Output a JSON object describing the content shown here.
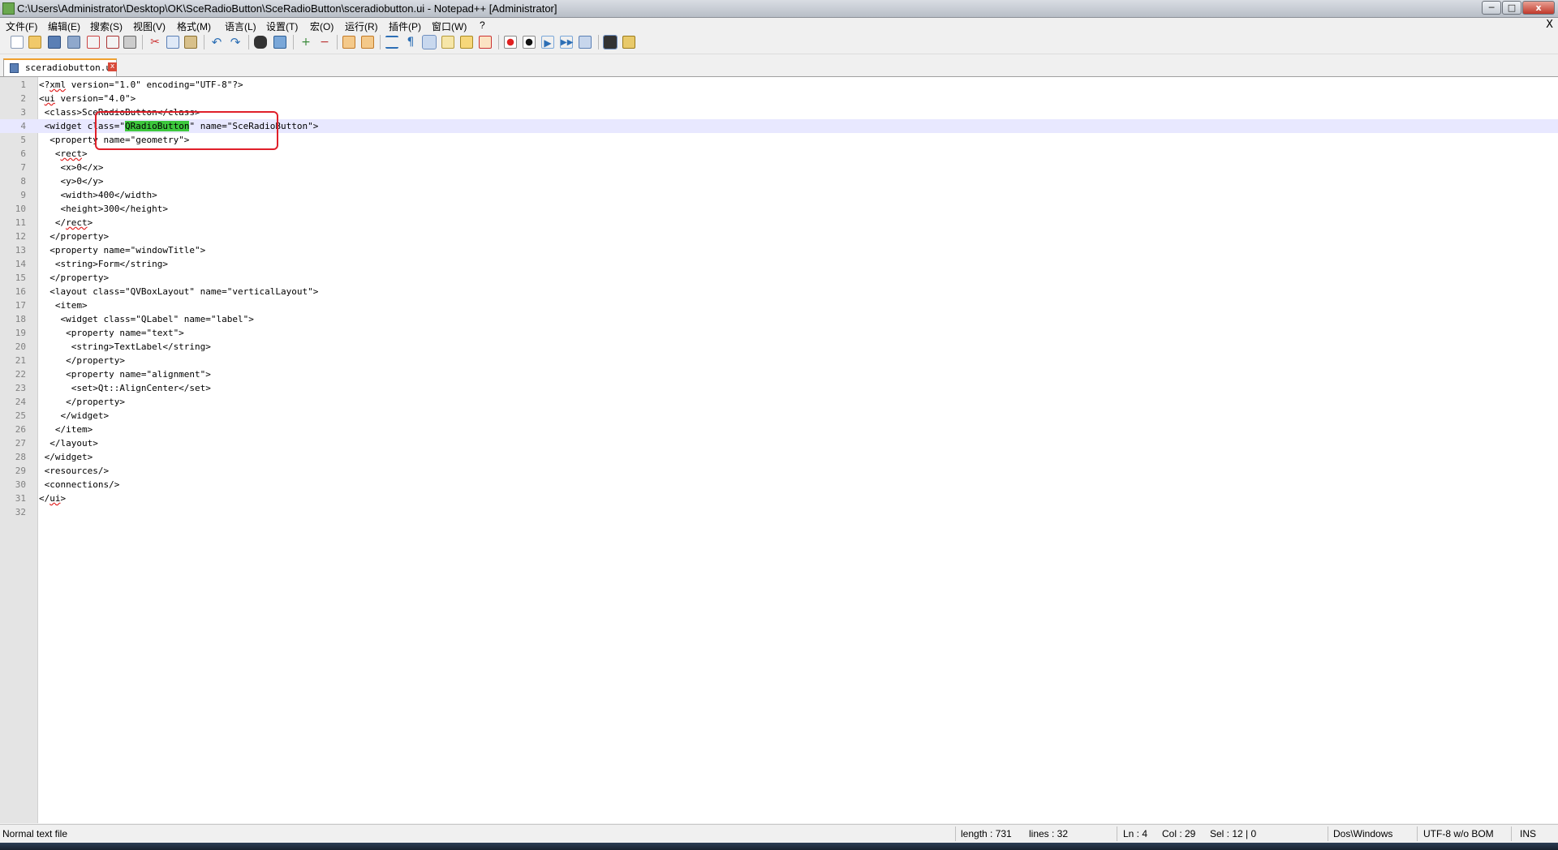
{
  "window": {
    "title": "C:\\Users\\Administrator\\Desktop\\OK\\SceRadioButton\\SceRadioButton\\sceradiobutton.ui - Notepad++ [Administrator]",
    "btn_min": "─",
    "btn_max": "□",
    "btn_close": "x"
  },
  "menu": {
    "items": [
      "文件(F)",
      "编辑(E)",
      "搜索(S)",
      "视图(V)",
      "格式(M)",
      "语言(L)",
      "设置(T)",
      "宏(O)",
      "运行(R)",
      "插件(P)",
      "窗口(W)",
      "?"
    ],
    "close_doc": "X"
  },
  "toolbar": {
    "icons": [
      "new-file-icon",
      "open-file-icon",
      "save-icon",
      "save-all-icon",
      "close-icon",
      "close-all-icon",
      "print-icon",
      "cut-icon",
      "copy-icon",
      "paste-icon",
      "undo-icon",
      "redo-icon",
      "find-icon",
      "replace-icon",
      "zoom-in-icon",
      "zoom-out-icon",
      "sync-vertical-icon",
      "sync-horizontal-icon",
      "word-wrap-icon",
      "show-all-chars-icon",
      "indent-guide-icon",
      "doc-map-icon",
      "function-list-icon",
      "folder-workspace-icon",
      "record-macro-icon",
      "stop-record-icon",
      "play-macro-icon",
      "run-macro-multiple-icon",
      "save-macro-icon",
      "spell-check-icon",
      "spell-options-icon"
    ]
  },
  "tab": {
    "filename": "sceradiobutton.ui",
    "close": "x"
  },
  "editor": {
    "lines": [
      {
        "n": "1",
        "text": "<?xml version=\"1.0\" encoding=\"UTF-8\"?>"
      },
      {
        "n": "2",
        "text": "<ui version=\"4.0\">"
      },
      {
        "n": "3",
        "text": " <class>SceRadioButton</class>"
      },
      {
        "n": "4",
        "text": " <widget class=\"QRadioButton\" name=\"SceRadioButton\">"
      },
      {
        "n": "5",
        "text": "  <property name=\"geometry\">"
      },
      {
        "n": "6",
        "text": "   <rect>"
      },
      {
        "n": "7",
        "text": "    <x>0</x>"
      },
      {
        "n": "8",
        "text": "    <y>0</y>"
      },
      {
        "n": "9",
        "text": "    <width>400</width>"
      },
      {
        "n": "10",
        "text": "    <height>300</height>"
      },
      {
        "n": "11",
        "text": "   </rect>"
      },
      {
        "n": "12",
        "text": "  </property>"
      },
      {
        "n": "13",
        "text": "  <property name=\"windowTitle\">"
      },
      {
        "n": "14",
        "text": "   <string>Form</string>"
      },
      {
        "n": "15",
        "text": "  </property>"
      },
      {
        "n": "16",
        "text": "  <layout class=\"QVBoxLayout\" name=\"verticalLayout\">"
      },
      {
        "n": "17",
        "text": "   <item>"
      },
      {
        "n": "18",
        "text": "    <widget class=\"QLabel\" name=\"label\">"
      },
      {
        "n": "19",
        "text": "     <property name=\"text\">"
      },
      {
        "n": "20",
        "text": "      <string>TextLabel</string>"
      },
      {
        "n": "21",
        "text": "     </property>"
      },
      {
        "n": "22",
        "text": "     <property name=\"alignment\">"
      },
      {
        "n": "23",
        "text": "      <set>Qt::AlignCenter</set>"
      },
      {
        "n": "24",
        "text": "     </property>"
      },
      {
        "n": "25",
        "text": "    </widget>"
      },
      {
        "n": "26",
        "text": "   </item>"
      },
      {
        "n": "27",
        "text": "  </layout>"
      },
      {
        "n": "28",
        "text": " </widget>"
      },
      {
        "n": "29",
        "text": " <resources/>"
      },
      {
        "n": "30",
        "text": " <connections/>"
      },
      {
        "n": "31",
        "text": "</ui>"
      },
      {
        "n": "32",
        "text": ""
      }
    ],
    "current_line": 4,
    "selected_text": "QRadioButton",
    "line4_before": " <widget class=\"",
    "line4_after": "\" name=\"SceRadioButton\">"
  },
  "status": {
    "file_type": "Normal text file",
    "length": "length : 731",
    "lines": "lines : 32",
    "ln": "Ln : 4",
    "col": "Col : 29",
    "sel": "Sel : 12 | 0",
    "eol": "Dos\\Windows",
    "encoding": "UTF-8 w/o BOM",
    "mode": "INS"
  },
  "colors": {
    "selection_highlight": "#3dc83d",
    "annotation_box": "#e0202a",
    "current_line_bg": "#e8e8ff"
  }
}
